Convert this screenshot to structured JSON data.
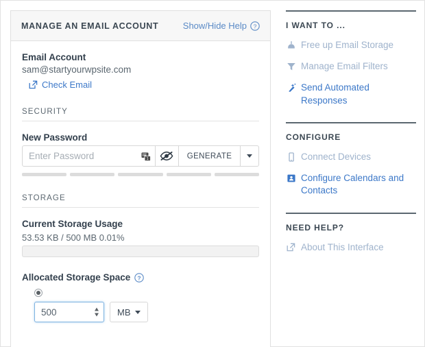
{
  "card": {
    "title": "MANAGE AN EMAIL ACCOUNT",
    "help_toggle": "Show/Hide Help",
    "email": {
      "label": "Email Account",
      "address": "sam@startyourwpsite.com",
      "check_email_link": "Check Email"
    },
    "security": {
      "heading": "SECURITY",
      "password_label": "New Password",
      "password_value": "",
      "password_placeholder": "Enter Password",
      "generate_label": "GENERATE",
      "strength_segments": 5
    },
    "storage": {
      "heading": "STORAGE",
      "usage_label": "Current Storage Usage",
      "usage_text": "53.53 KB / 500 MB 0.01%",
      "usage_percent": 0.01,
      "allocated_label": "Allocated Storage Space",
      "allocated_value": "500",
      "allocated_unit": "MB"
    }
  },
  "sidebar": {
    "blocks": [
      {
        "title": "I WANT TO ...",
        "links": [
          {
            "label": "Free up Email Storage",
            "icon": "broom-icon",
            "tone": "muted"
          },
          {
            "label": "Manage Email Filters",
            "icon": "funnel-icon",
            "tone": "muted"
          },
          {
            "label": "Send Automated Responses",
            "icon": "magic-wand-icon",
            "tone": "strong"
          }
        ]
      },
      {
        "title": "CONFIGURE",
        "links": [
          {
            "label": "Connect Devices",
            "icon": "mobile-device-icon",
            "tone": "muted"
          },
          {
            "label": "Configure Calendars and Contacts",
            "icon": "contact-card-icon",
            "tone": "strong"
          }
        ]
      },
      {
        "title": "NEED HELP?",
        "links": [
          {
            "label": "About This Interface",
            "icon": "external-link-icon",
            "tone": "muted"
          }
        ]
      }
    ]
  },
  "colors": {
    "link_blue": "#3c78c8",
    "muted_blue": "#9fb3cc",
    "heading": "#3b4752",
    "focus_border": "#7eb3e0"
  }
}
